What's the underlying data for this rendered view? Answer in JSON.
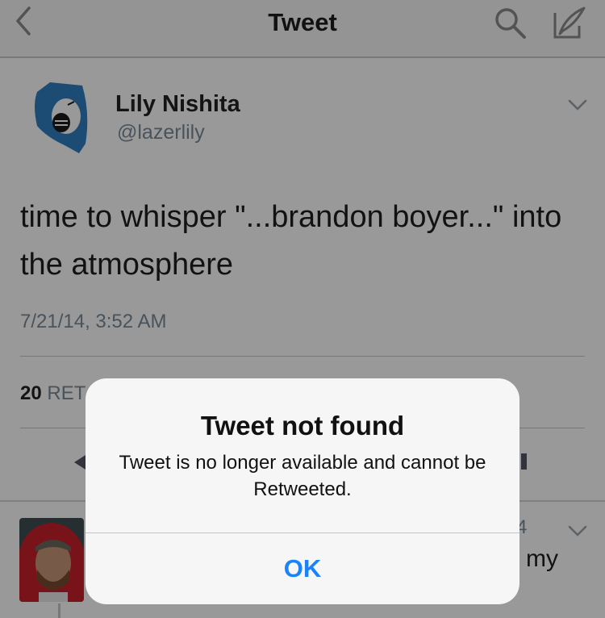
{
  "navbar": {
    "title": "Tweet"
  },
  "tweet": {
    "author_name": "Lily Nishita",
    "author_handle": "@lazerlily",
    "text": "time to whisper \"...brandon boyer...\" into the atmosphere",
    "timestamp": "7/21/14, 3:52 AM",
    "retweet_count": "20",
    "retweet_label_partial": "RET"
  },
  "reply": {
    "time_partial": "4",
    "text_partial": "my"
  },
  "alert": {
    "title": "Tweet not found",
    "message": "Tweet is no longer available and cannot be Retweeted.",
    "ok_label": "OK",
    "ok_color": "#1a82fb"
  },
  "icons": [
    "back-chevron-icon",
    "search-icon",
    "compose-icon",
    "chevron-down-icon",
    "reply-icon",
    "more-icon"
  ]
}
